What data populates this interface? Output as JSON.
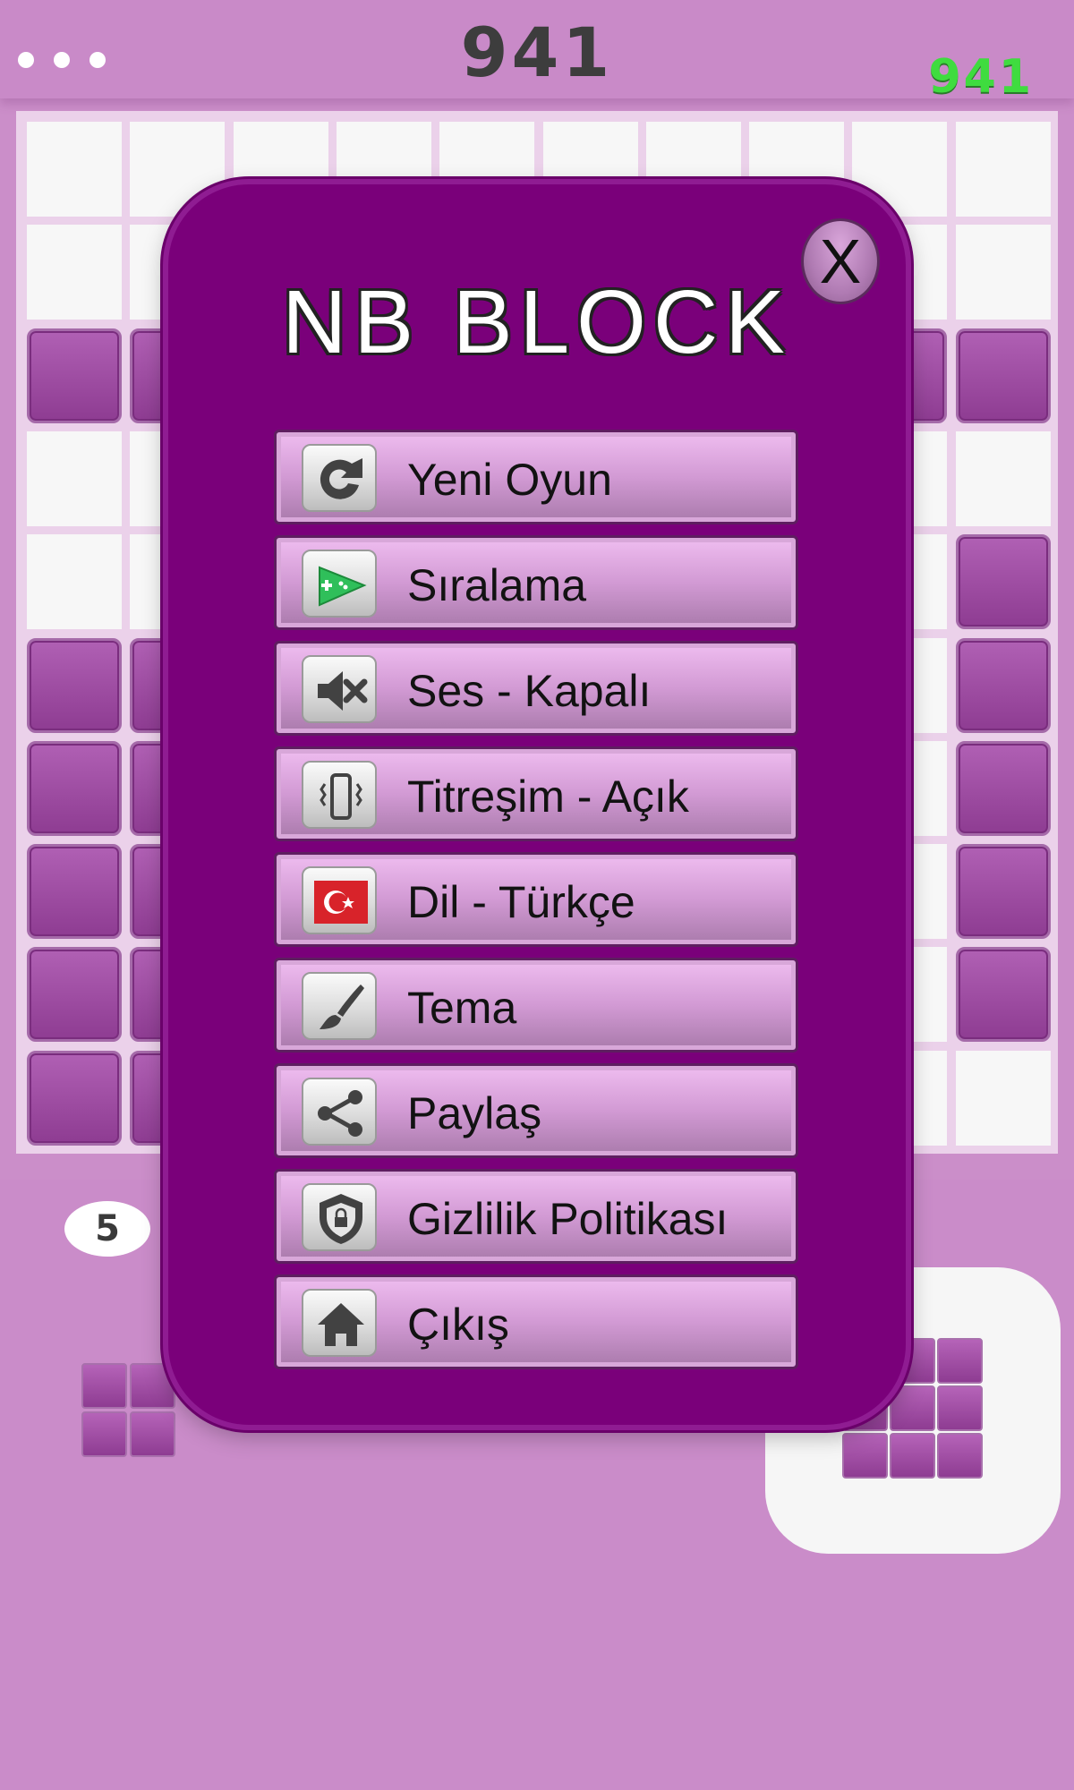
{
  "header": {
    "score": "941",
    "best_score": "941",
    "menu_icon": "more-dots-icon"
  },
  "tray": {
    "pieces_left": "5"
  },
  "dialog": {
    "title": "NB BLOCK",
    "close_label": "X",
    "items": [
      {
        "label": "Yeni Oyun",
        "icon": "restart-icon"
      },
      {
        "label": "Sıralama",
        "icon": "play-games-icon"
      },
      {
        "label": "Ses - Kapalı",
        "icon": "sound-off-icon"
      },
      {
        "label": "Titreşim - Açık",
        "icon": "vibration-icon"
      },
      {
        "label": "Dil - Türkçe",
        "icon": "turkish-flag-icon"
      },
      {
        "label": "Tema",
        "icon": "paintbrush-icon"
      },
      {
        "label": "Paylaş",
        "icon": "share-icon"
      },
      {
        "label": "Gizlilik Politikası",
        "icon": "privacy-shield-icon"
      },
      {
        "label": "Çıkış",
        "icon": "home-icon"
      }
    ]
  },
  "colors": {
    "background": "#cb8ec9",
    "dialog": "#7a007a",
    "block": "#9c48a0",
    "best_score": "#3fdc3f"
  }
}
